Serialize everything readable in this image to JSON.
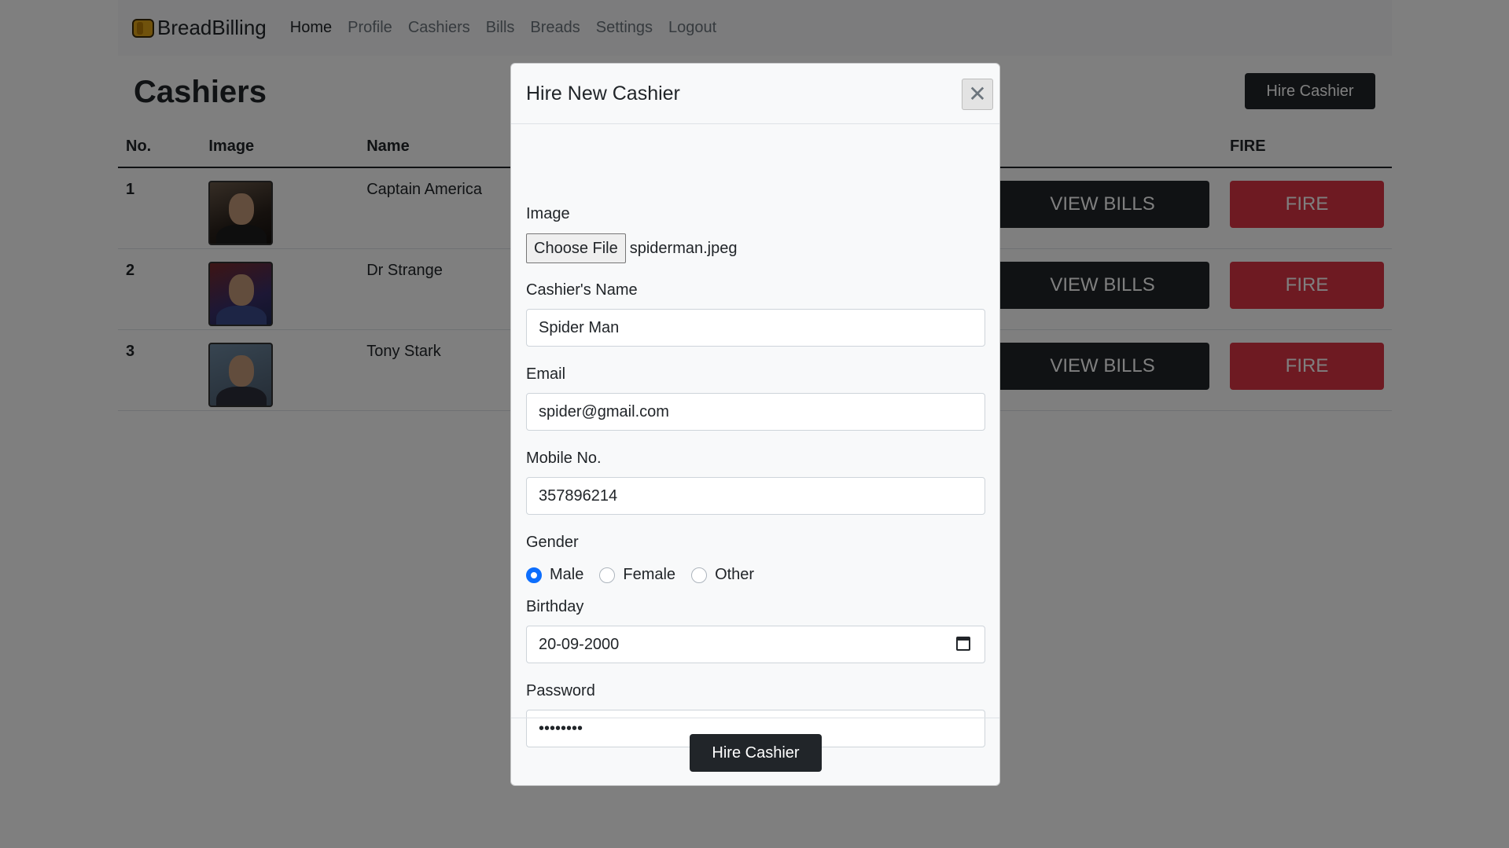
{
  "navbar": {
    "brand": "BreadBilling",
    "links": [
      "Home",
      "Profile",
      "Cashiers",
      "Bills",
      "Breads",
      "Settings",
      "Logout"
    ]
  },
  "page": {
    "title": "Cashiers",
    "hire_button": "Hire Cashier"
  },
  "table": {
    "headers": {
      "no": "No.",
      "image": "Image",
      "name": "Name",
      "fire": "FIRE"
    },
    "rows": [
      {
        "no": "1",
        "name": "Captain America",
        "bills": "VIEW BILLS",
        "fire": "FIRE"
      },
      {
        "no": "2",
        "name": "Dr Strange",
        "bills": "VIEW BILLS",
        "fire": "FIRE"
      },
      {
        "no": "3",
        "name": "Tony Stark",
        "bills": "VIEW BILLS",
        "fire": "FIRE"
      }
    ]
  },
  "modal": {
    "title": "Hire New Cashier",
    "close": "✕",
    "image_label": "Image",
    "file_button": "Choose File",
    "file_name": "spiderman.jpeg",
    "name_label": "Cashier's Name",
    "name_value": "Spider Man",
    "email_label": "Email",
    "email_value": "spider@gmail.com",
    "mobile_label": "Mobile No.",
    "mobile_value": "357896214",
    "gender_label": "Gender",
    "gender_options": [
      "Male",
      "Female",
      "Other"
    ],
    "gender_selected": "Male",
    "birthday_label": "Birthday",
    "birthday_value": "20-09-2000",
    "password_label": "Password",
    "password_value": "••••••••",
    "submit": "Hire Cashier"
  },
  "colors": {
    "dark": "#212529",
    "danger": "#dc3545",
    "primary": "#0d6efd",
    "backdrop": "rgba(0,0,0,0.5)"
  }
}
